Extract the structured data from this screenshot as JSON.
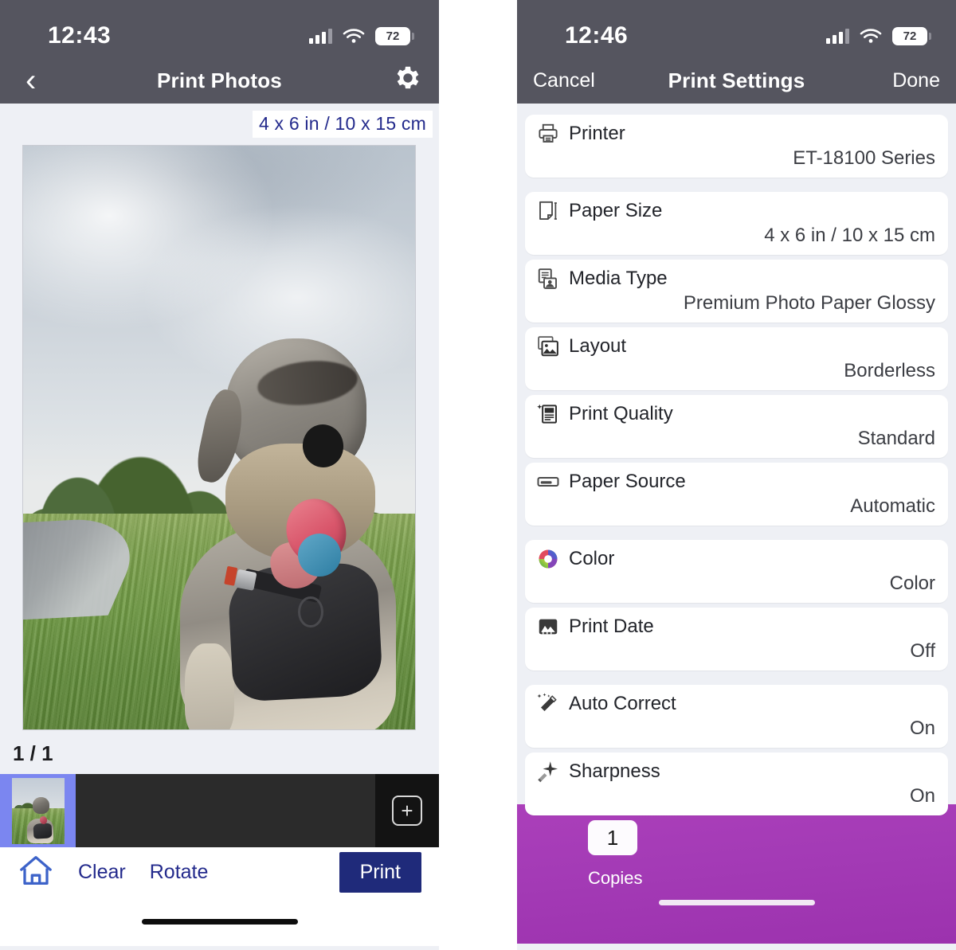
{
  "left": {
    "status": {
      "time": "12:43",
      "battery": "72",
      "signal_icon": "cellular-signal-icon",
      "wifi_icon": "wifi-icon",
      "battery_icon": "battery-icon"
    },
    "nav": {
      "back_icon": "chevron-left-icon",
      "title": "Print Photos",
      "settings_icon": "gear-icon"
    },
    "paper_size_chip": "4 x 6 in / 10 x 15 cm",
    "photo_alt": "schnauzer-dog-with-ball-in-field-photo",
    "counter": "1 / 1",
    "filmstrip": {
      "thumbnail_alt": "photo-thumbnail",
      "add_icon": "plus-in-square-icon"
    },
    "toolbar": {
      "home_icon": "home-icon",
      "clear_label": "Clear",
      "rotate_label": "Rotate",
      "print_label": "Print"
    }
  },
  "right": {
    "status": {
      "time": "12:46",
      "battery": "72",
      "signal_icon": "cellular-signal-icon",
      "wifi_icon": "wifi-icon",
      "battery_icon": "battery-icon"
    },
    "nav": {
      "cancel_label": "Cancel",
      "title": "Print Settings",
      "done_label": "Done"
    },
    "groups": [
      {
        "rows": [
          {
            "icon": "printer-icon",
            "label": "Printer",
            "value": "ET-18100 Series"
          }
        ]
      },
      {
        "rows": [
          {
            "icon": "paper-size-icon",
            "label": "Paper Size",
            "value": "4 x 6 in / 10 x 15 cm"
          },
          {
            "icon": "media-type-icon",
            "label": "Media Type",
            "value": "Premium Photo Paper Glossy"
          },
          {
            "icon": "layout-icon",
            "label": "Layout",
            "value": "Borderless"
          },
          {
            "icon": "print-quality-icon",
            "label": "Print Quality",
            "value": "Standard"
          },
          {
            "icon": "paper-source-icon",
            "label": "Paper Source",
            "value": "Automatic"
          }
        ]
      },
      {
        "rows": [
          {
            "icon": "color-wheel-icon",
            "label": "Color",
            "value": "Color"
          },
          {
            "icon": "print-date-icon",
            "label": "Print Date",
            "value": "Off"
          }
        ]
      },
      {
        "rows": [
          {
            "icon": "magic-wand-icon",
            "label": "Auto Correct",
            "value": "On"
          },
          {
            "icon": "sparkle-icon",
            "label": "Sharpness",
            "value": "On"
          }
        ]
      }
    ],
    "footer": {
      "copies_value": "1",
      "copies_label": "Copies"
    }
  },
  "colors": {
    "statusbar": "#55555f",
    "page_background": "#eef0f5",
    "accent_blue": "#232a8c",
    "print_button": "#1f2a7a",
    "thumb_selection": "#7b86f0",
    "purple_footer_top": "#ab3fba",
    "purple_footer_bottom": "#9c32ae"
  }
}
